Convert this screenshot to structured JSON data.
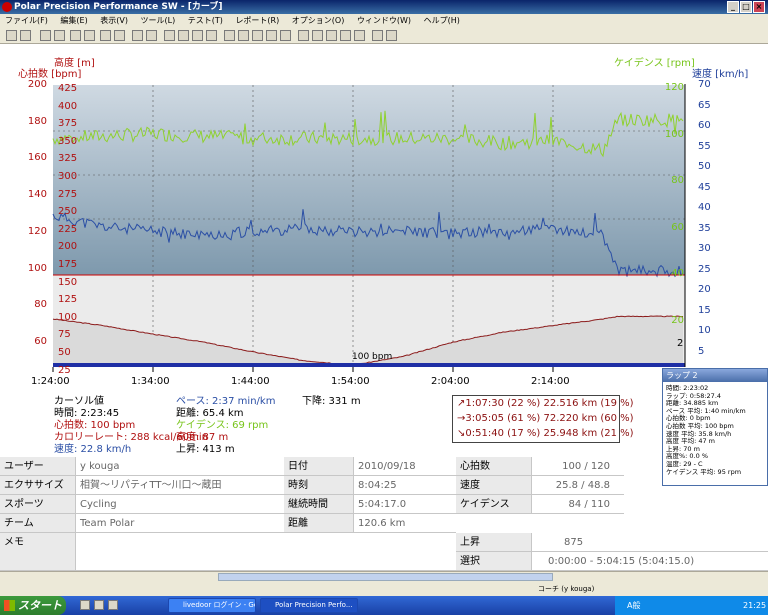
{
  "window": {
    "title": "Polar Precision Performance SW - [カーブ]",
    "min": "_",
    "max": "□",
    "close": "×"
  },
  "menu": [
    "ファイル(F)",
    "編集(E)",
    "表示(V)",
    "ツール(L)",
    "テスト(T)",
    "レポート(R)",
    "オプション(O)",
    "ウィンドウ(W)",
    "ヘルプ(H)"
  ],
  "graph": {
    "altitude_label": "高度 [m]",
    "heart_rate_label": "心拍数 [bpm]",
    "cadence_label": "ケイデンス [rpm]",
    "speed_label": "速度 [km/h]",
    "hr_ticks": [
      "200",
      "180",
      "160",
      "140",
      "120",
      "100",
      "80",
      "60"
    ],
    "alt_ticks": [
      "425",
      "400",
      "375",
      "350",
      "325",
      "300",
      "275",
      "250",
      "225",
      "200",
      "175",
      "150",
      "125",
      "100",
      "75",
      "50",
      "25"
    ],
    "cad_ticks": [
      "120",
      "100",
      "80",
      "60",
      "40",
      "20"
    ],
    "spd_ticks": [
      "70",
      "65",
      "60",
      "55",
      "50",
      "45",
      "40",
      "35",
      "30",
      "25",
      "20",
      "15",
      "10",
      "5"
    ],
    "time_ticks": [
      "1:24:00",
      "1:34:00",
      "1:44:00",
      "1:54:00",
      "2:04:00",
      "2:14:00"
    ],
    "hr_limit_label": "100 bpm",
    "lap_marker": "2"
  },
  "chart_data": {
    "type": "line",
    "x_label": "time",
    "x_ticks": [
      "1:24:00",
      "1:34:00",
      "1:44:00",
      "1:54:00",
      "2:04:00",
      "2:14:00"
    ],
    "heart_rate_axis": [
      50,
      200
    ],
    "speed_axis": [
      0,
      70
    ],
    "cadence_axis": [
      0,
      120
    ],
    "altitude_axis": [
      0,
      440
    ],
    "series": [
      {
        "name": "ケイデンス",
        "color": "#8fd12e",
        "x": [
          "1:24:00",
          "1:29:00",
          "1:34:00",
          "1:39:00",
          "1:44:00",
          "1:49:00",
          "1:54:00",
          "1:59:00",
          "2:04:00",
          "2:09:00",
          "2:14:00",
          "2:19:00",
          "2:20:30"
        ],
        "values": [
          97,
          98,
          99,
          98,
          97,
          97,
          97,
          97,
          97,
          95,
          96,
          92,
          105
        ]
      },
      {
        "name": "速度",
        "color": "#2b4fa5",
        "x": [
          "1:24:00",
          "1:29:00",
          "1:34:00",
          "1:39:00",
          "1:44:00",
          "1:49:00",
          "1:54:00",
          "1:59:00",
          "2:04:00",
          "2:09:00",
          "2:14:00",
          "2:19:00",
          "2:20:30"
        ],
        "values": [
          40.5,
          38,
          37,
          36,
          37,
          37.5,
          37,
          37,
          36.5,
          37,
          37.5,
          36,
          28
        ]
      },
      {
        "name": "高度",
        "color": "#8b1a1a",
        "x": [
          "1:24:00",
          "1:29:00",
          "1:34:00",
          "1:39:00",
          "1:44:00",
          "1:49:00",
          "1:54:00",
          "1:59:00",
          "2:04:00",
          "2:09:00",
          "2:14:00",
          "2:19:00",
          "2:20:30"
        ],
        "values": [
          85,
          75,
          62,
          50,
          35,
          22,
          15,
          28,
          50,
          65,
          75,
          85,
          89
        ]
      }
    ]
  },
  "cursor": {
    "title": "カーソル値",
    "time": "時間: 2:23:45",
    "heart_rate": "心拍数: 100 bpm",
    "calorie": "カロリーレート: 288 kcal/60min",
    "speed": "速度: 22.8 km/h",
    "pace": "ペース: 2:37 min/km",
    "distance": "距離: 65.4 km",
    "cadence": "ケイデンス: 69 rpm",
    "altitude": "高度: 87 m",
    "ascent": "上昇: 413 m",
    "descent": "下降: 331 m"
  },
  "zones": [
    "↗1:07:30 (22 %) 22.516 km (19 %)",
    "→3:05:05 (61 %) 72.220 km (60 %)",
    "↘0:51:40 (17 %) 25.948 km (21 %)"
  ],
  "lap_tooltip": {
    "title": "ラップ 2",
    "rows": [
      "時間: 2:23:02",
      "ラップ: 0:58:27.4",
      "距離: 34.885 km",
      "ペース 平均: 1:40 min/km",
      "心拍数: 0 bpm",
      "心拍数 平均: 100 bpm",
      "速度 平均: 35.8 km/h",
      "高度 平均: 47 m",
      "上昇: 70 m",
      "高度%: 0.0 %",
      "温度: 29 - C",
      "ケイデンス 平均: 95 rpm"
    ]
  },
  "summary": {
    "user_label": "ユーザー",
    "user": "y kouga",
    "exercise_label": "エクササイズ",
    "exercise": "相賀～リパティTT～川口～蔵田",
    "sport_label": "スポーツ",
    "sport": "Cycling",
    "team_label": "チーム",
    "team": "Team Polar",
    "memo_label": "メモ",
    "date_label": "日付",
    "date": "2010/09/18",
    "time_label": "時刻",
    "time": "8:04:25",
    "duration_label": "継続時間",
    "duration": "5:04:17.0",
    "distance_label": "距離",
    "distance": "120.6 km",
    "hr_label": "心拍数",
    "hr": "100 / 120",
    "speed_label": "速度",
    "speed": "25.8 / 48.8",
    "cad_label": "ケイデンス",
    "cad": "84 / 110",
    "ascent_label": "上昇",
    "ascent": "875",
    "select_label": "選択",
    "select": "0:00:00 - 5:04:15 (5:04:15.0)"
  },
  "status": "コーチ (y kouga)",
  "taskbar": {
    "start": "スタート",
    "tasks": [
      "livedoor ログイン - Go...",
      "Polar Precision Perfo..."
    ],
    "clock": "21:25",
    "ime": "A般"
  }
}
